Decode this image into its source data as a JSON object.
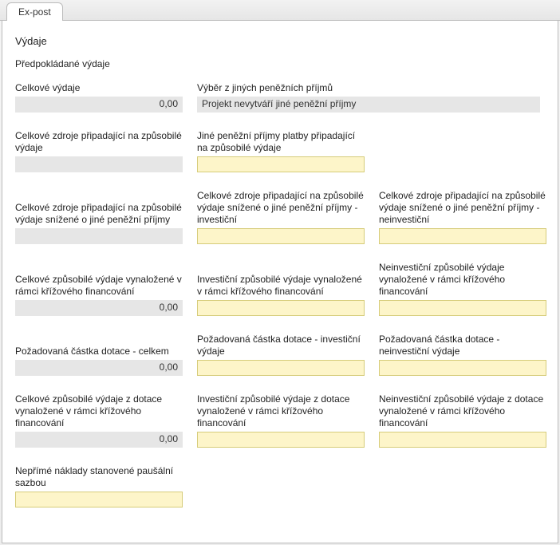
{
  "tab": {
    "label": "Ex-post"
  },
  "section": {
    "title": "Výdaje"
  },
  "subsection": {
    "title": "Předpokládané výdaje"
  },
  "top": {
    "left": {
      "label": "Celkové výdaje",
      "value": "0,00"
    },
    "right": {
      "label": "Výběr z jiných peněžních příjmů",
      "value": "Projekt nevytváří jiné peněžní příjmy"
    }
  },
  "rows": [
    {
      "c1": {
        "label": "Celkové zdroje připadající na způsobilé výdaje",
        "type": "gray",
        "value": ""
      },
      "c2": {
        "label": "Jiné peněžní příjmy platby připadající na způsobilé výdaje",
        "type": "yellow",
        "value": ""
      },
      "c3": null
    },
    {
      "c1": {
        "label": "Celkové zdroje připadající na způsobilé výdaje snížené o jiné peněžní příjmy",
        "type": "gray",
        "value": ""
      },
      "c2": {
        "label": "Celkové zdroje připadající na způsobilé výdaje snížené o jiné peněžní příjmy - investiční",
        "type": "yellow",
        "value": ""
      },
      "c3": {
        "label": "Celkové zdroje připadající na způsobilé výdaje snížené o jiné peněžní příjmy - neinvestiční",
        "type": "yellow",
        "value": ""
      }
    },
    {
      "c1": {
        "label": "Celkové způsobilé výdaje vynaložené v rámci křížového financování",
        "type": "gray",
        "value": "0,00"
      },
      "c2": {
        "label": "Investiční způsobilé výdaje vynaložené v rámci křížového financování",
        "type": "yellow",
        "value": ""
      },
      "c3": {
        "label": "Neinvestiční způsobilé výdaje vynaložené v rámci křížového financování",
        "type": "yellow",
        "value": ""
      }
    },
    {
      "c1": {
        "label": "Požadovaná částka dotace - celkem",
        "type": "gray",
        "value": "0,00"
      },
      "c2": {
        "label": "Požadovaná částka dotace - investiční výdaje",
        "type": "yellow",
        "value": ""
      },
      "c3": {
        "label": "Požadovaná částka dotace - neinvestiční výdaje",
        "type": "yellow",
        "value": ""
      }
    },
    {
      "c1": {
        "label": "Celkové způsobilé výdaje z dotace vynaložené v rámci křížového financování",
        "type": "gray",
        "value": "0,00"
      },
      "c2": {
        "label": "Investiční způsobilé výdaje z dotace vynaložené v rámci křížového financování",
        "type": "yellow",
        "value": ""
      },
      "c3": {
        "label": "Neinvestiční způsobilé výdaje z dotace vynaložené v rámci křížového financování",
        "type": "yellow",
        "value": ""
      }
    },
    {
      "c1": {
        "label": "Nepřímé náklady stanovené paušální sazbou",
        "type": "yellow",
        "value": ""
      },
      "c2": null,
      "c3": null
    }
  ]
}
